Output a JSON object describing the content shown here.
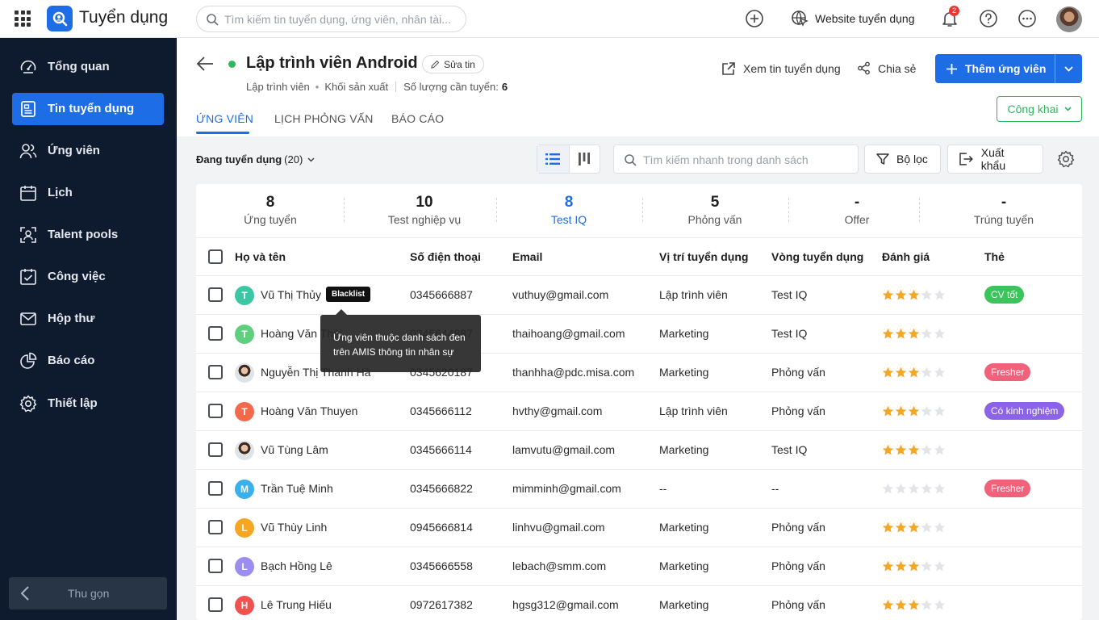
{
  "app": {
    "name": "Tuyển dụng",
    "search_placeholder": "Tìm kiếm tin tuyển dụng, ứng viên, nhân tài...",
    "website_label": "Website tuyển dụng",
    "notification_count": "2"
  },
  "sidebar": {
    "items": [
      {
        "label": "Tổng quan",
        "icon": "dashboard-icon"
      },
      {
        "label": "Tin tuyển dụng",
        "icon": "job-post-icon",
        "active": true
      },
      {
        "label": "Ứng viên",
        "icon": "candidates-icon"
      },
      {
        "label": "Lịch",
        "icon": "calendar-icon"
      },
      {
        "label": "Talent pools",
        "icon": "talent-pool-icon"
      },
      {
        "label": "Công việc",
        "icon": "task-icon"
      },
      {
        "label": "Hộp thư",
        "icon": "mail-icon"
      },
      {
        "label": "Báo cáo",
        "icon": "report-icon"
      },
      {
        "label": "Thiết lập",
        "icon": "settings-icon"
      }
    ],
    "collapse_label": "Thu gọn"
  },
  "job": {
    "title": "Lập trình viên Android",
    "edit_label": "Sửa tin",
    "position": "Lập trình viên",
    "department": "Khối sản xuất",
    "quantity_label": "Số lượng cần tuyển:",
    "quantity": "6",
    "view_post_label": "Xem tin tuyển dụng",
    "share_label": "Chia sẻ",
    "add_candidate_label": "Thêm ứng viên",
    "visibility_label": "Công khai"
  },
  "tabs": [
    "ỨNG VIÊN",
    "LỊCH PHỎNG VẤN",
    "BÁO CÁO"
  ],
  "toolbar": {
    "status_label": "Đang tuyển dụng",
    "status_count": "(20)",
    "search_placeholder": "Tìm kiếm nhanh trong danh sách",
    "filter_label": "Bộ lọc",
    "export_label": "Xuất khẩu"
  },
  "stages": [
    {
      "count": "8",
      "label": "Ứng tuyển"
    },
    {
      "count": "10",
      "label": "Test nghiệp vụ"
    },
    {
      "count": "8",
      "label": "Test IQ",
      "active": true
    },
    {
      "count": "5",
      "label": "Phỏng vấn"
    },
    {
      "count": "-",
      "label": "Offer"
    },
    {
      "count": "-",
      "label": "Trúng tuyển"
    }
  ],
  "table": {
    "headers": [
      "Họ và tên",
      "Số điện thoại",
      "Email",
      "Vị trí tuyển dụng",
      "Vòng tuyển dụng",
      "Đánh giá",
      "Thẻ"
    ],
    "rows": [
      {
        "initial": "T",
        "avatar_color": "#3cc6a4",
        "name": "Vũ Thị Thủy",
        "blacklist": "Blacklist",
        "phone": "0345666887",
        "email": "vuthuy@gmail.com",
        "position": "Lập trình viên",
        "round": "Test IQ",
        "rating": 3,
        "tag": "CV tốt",
        "tag_color": "#3cc45c"
      },
      {
        "initial": "T",
        "avatar_color": "#5fcf7f",
        "name": "Hoàng Văn Thái",
        "phone": "0345644887",
        "email": "thaihoang@gmail.com",
        "position": "Marketing",
        "round": "Test IQ",
        "rating": 3,
        "tag": "",
        "tag_color": ""
      },
      {
        "initial": "",
        "avatar_color": "",
        "photo": true,
        "name": "Nguyễn Thị Thanh Hà",
        "phone": "0345620187",
        "email": "thanhha@pdc.misa.com",
        "position": "Marketing",
        "round": "Phỏng vấn",
        "rating": 3,
        "tag": "Fresher",
        "tag_color": "#f0627a"
      },
      {
        "initial": "T",
        "avatar_color": "#f26a4b",
        "name": "Hoàng Văn Thuyen",
        "phone": "0345666112",
        "email": "hvthy@gmail.com",
        "position": "Lập trình viên",
        "round": "Phỏng vấn",
        "rating": 3,
        "tag": "Có kinh nghiệm",
        "tag_color": "#8a63e6"
      },
      {
        "initial": "",
        "avatar_color": "",
        "photo": true,
        "name": "Vũ Tùng Lâm",
        "phone": "0345666114",
        "email": "lamvutu@gmail.com",
        "position": "Marketing",
        "round": "Test IQ",
        "rating": 3,
        "tag": "",
        "tag_color": ""
      },
      {
        "initial": "M",
        "avatar_color": "#3ab0ea",
        "name": "Trần Tuệ Minh",
        "phone": "0345666822",
        "email": "mimminh@gmail.com",
        "position": "--",
        "round": "--",
        "rating": 0,
        "tag": "Fresher",
        "tag_color": "#f0627a"
      },
      {
        "initial": "L",
        "avatar_color": "#f5a623",
        "name": "Vũ Thùy Linh",
        "phone": "0945666814",
        "email": "linhvu@gmail.com",
        "position": "Marketing",
        "round": "Phỏng vấn",
        "rating": 3,
        "tag": "",
        "tag_color": ""
      },
      {
        "initial": "L",
        "avatar_color": "#9b8cf0",
        "name": "Bạch Hồng Lê",
        "phone": "0345666558",
        "email": "lebach@smm.com",
        "position": "Marketing",
        "round": "Phỏng vấn",
        "rating": 3,
        "tag": "",
        "tag_color": ""
      },
      {
        "initial": "H",
        "avatar_color": "#ef5350",
        "name": "Lê Trung Hiếu",
        "phone": "0972617382",
        "email": "hgsg312@gmail.com",
        "position": "Marketing",
        "round": "Phỏng vấn",
        "rating": 3,
        "tag": "",
        "tag_color": ""
      }
    ]
  },
  "tooltip": {
    "text": "Ứng viên thuộc danh sách đen trên AMIS thông tin nhân sự"
  },
  "colors": {
    "primary": "#1d6ee6",
    "sidebar_bg": "#0e1b2e",
    "success": "#2eb85c",
    "star": "#f5a623",
    "star_empty": "#e2e4e8"
  }
}
